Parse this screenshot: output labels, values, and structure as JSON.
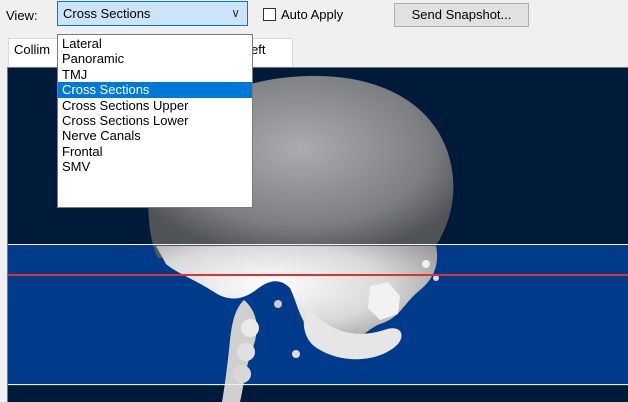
{
  "toolbar": {
    "view_label": "View:",
    "view_selected": "Cross Sections",
    "auto_apply_label": "Auto Apply",
    "auto_apply_checked": false,
    "send_snapshot_label": "Send Snapshot..."
  },
  "tabs": {
    "collim_partial": "Collim",
    "left_partial": "eft"
  },
  "dropdown": {
    "options": [
      {
        "label": "Lateral",
        "selected": false
      },
      {
        "label": "Panoramic",
        "selected": false
      },
      {
        "label": "TMJ",
        "selected": false
      },
      {
        "label": "Cross Sections",
        "selected": true
      },
      {
        "label": "Cross Sections Upper",
        "selected": false
      },
      {
        "label": "Cross Sections Lower",
        "selected": false
      },
      {
        "label": "Nerve Canals",
        "selected": false
      },
      {
        "label": "Frontal",
        "selected": false
      },
      {
        "label": "SMV",
        "selected": false
      }
    ]
  },
  "colors": {
    "viewport_bg": "#001a3a",
    "band_bg": "#003b8b",
    "selection": "#0078d7",
    "slice_line": "#e03030"
  }
}
